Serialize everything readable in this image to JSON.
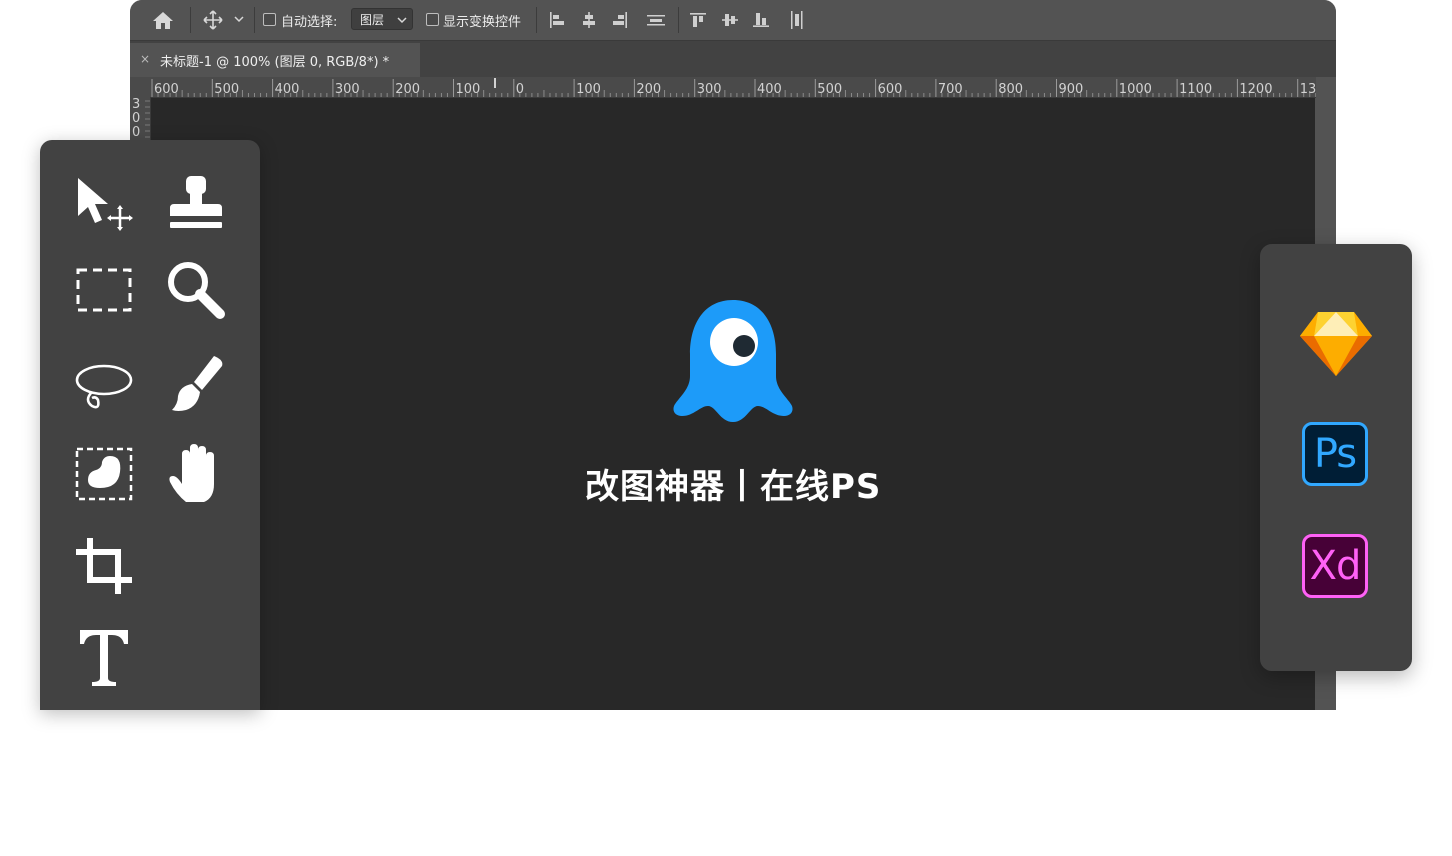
{
  "options_bar": {
    "auto_select_label": "自动选择:",
    "layer_select_value": "图层",
    "show_transform_label": "显示变换控件"
  },
  "document_tab": {
    "close_glyph": "×",
    "title": "未标题-1 @ 100% (图层 0, RGB/8*) *"
  },
  "ruler_h_labels": [
    "600",
    "500",
    "400",
    "300",
    "200",
    "100",
    "0",
    "100",
    "200",
    "300",
    "400",
    "500",
    "600",
    "700",
    "800",
    "900",
    "1000",
    "1100",
    "1200",
    "13"
  ],
  "ruler_v_labels": [
    "3",
    "0",
    "0"
  ],
  "canvas": {
    "brand_text": "改图神器丨在线PS",
    "colors": {
      "ghost": "#1d9bf9",
      "canvas_bg": "#282828"
    }
  },
  "tools": [
    {
      "name": "move-tool",
      "icon": "arrow-move-icon"
    },
    {
      "name": "stamp-tool",
      "icon": "stamp-icon"
    },
    {
      "name": "marquee-tool",
      "icon": "dashed-rect-icon"
    },
    {
      "name": "zoom-tool",
      "icon": "magnifier-icon"
    },
    {
      "name": "lasso-tool",
      "icon": "lasso-icon"
    },
    {
      "name": "brush-tool",
      "icon": "brush-icon"
    },
    {
      "name": "quick-selection-tool",
      "icon": "quick-select-icon"
    },
    {
      "name": "hand-tool",
      "icon": "hand-icon"
    },
    {
      "name": "crop-tool",
      "icon": "crop-icon"
    },
    {
      "name": "type-tool",
      "icon": "type-icon"
    }
  ],
  "apps": {
    "sketch": {
      "icon": "sketch-diamond-icon"
    },
    "photoshop": {
      "label": "Ps",
      "color": "#31a8ff",
      "bg": "#001e36"
    },
    "xd": {
      "label": "Xd",
      "color": "#ff61f6",
      "bg": "#470137"
    }
  }
}
